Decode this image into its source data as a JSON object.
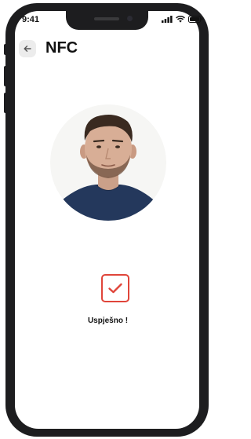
{
  "status_bar": {
    "time": "9:41",
    "icons": [
      "signal-icon",
      "wifi-icon",
      "battery-icon"
    ]
  },
  "header": {
    "back_icon": "arrow-left-icon",
    "title": "NFC"
  },
  "face_scan": {
    "photo": "person-portrait",
    "ring_color": "#e0453a"
  },
  "result": {
    "icon": "check-icon",
    "label": "Uspješno !",
    "accent_color": "#e0453a"
  }
}
